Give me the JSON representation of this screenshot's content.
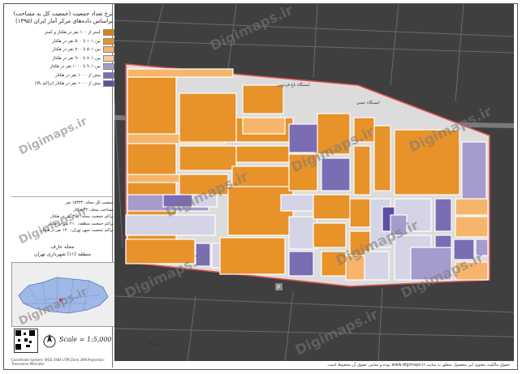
{
  "title_lines": [
    "نرخ تعداد جمعیت (جمعیت کل به مساحت)",
    "براساس داده‌های مرکز آمار ایران (۱۳۹۵)"
  ],
  "legend": [
    {
      "label": "کمتر از ۱۰۰ نفر در هکتار و کمتر",
      "color": "#d9820f"
    },
    {
      "label": "بین ۱۰۱ تا ۵۰۰ نفر در هکتار",
      "color": "#e8922a"
    },
    {
      "label": "بین ۵۰۱ تا ۷۰۰ نفر در هکتار",
      "color": "#f7b56c"
    },
    {
      "label": "بین ۷۰۱ تا ۹۰۰ نفر در هکتار",
      "color": "#f9cc99"
    },
    {
      "label": "بین ۹۰۱ تا ۱۰۰۰ نفر در هکتار",
      "color": "#a59bcc"
    },
    {
      "label": "بیش از ۱۰۰۰ نفر در هکتار",
      "color": "#7a6db3"
    },
    {
      "label": "بیش از ۱۰۰۰ نفر در هکتار (تراکم بالا)",
      "color": "#5e4fa2"
    }
  ],
  "stats": [
    "جمعیت کل محله: ۱۵۳۳۴ نفر",
    "مساحت محله: ۴۲ هکتار",
    "تراکم جمعیت محله: ۳۶۵ نفر در هکتار",
    "تراکم جمعیت منطقه: ۲۱۰ نفر در هکتار",
    "تراکم جمعیت شهر تهران: ۱۴۰ نفر در هکتار"
  ],
  "location_title": "محله عارف",
  "location_subtitle": "منطقه (۱۱) شهرداری تهران",
  "scale_text": "Scale = 1:5,000",
  "north_label": "N",
  "footer_left": "Coordinate System: WGS 1984 UTM Zone 39N Projection: Transverse Mercator",
  "footer_text": "حقوق مالکیت معنوی این محصول متعلق به سایت www.digimaps.ir بوده و تمامی حقوق آن محفوظ است.",
  "watermark": "Digimaps.ir",
  "map_labels": [
    "ایستگاه باغ فردوس",
    "ایستگاه حسن",
    "ایستگاه"
  ],
  "colors": {
    "boundary": "#e05050",
    "road": "#dcdcdc",
    "background": "#3f3f3f"
  }
}
